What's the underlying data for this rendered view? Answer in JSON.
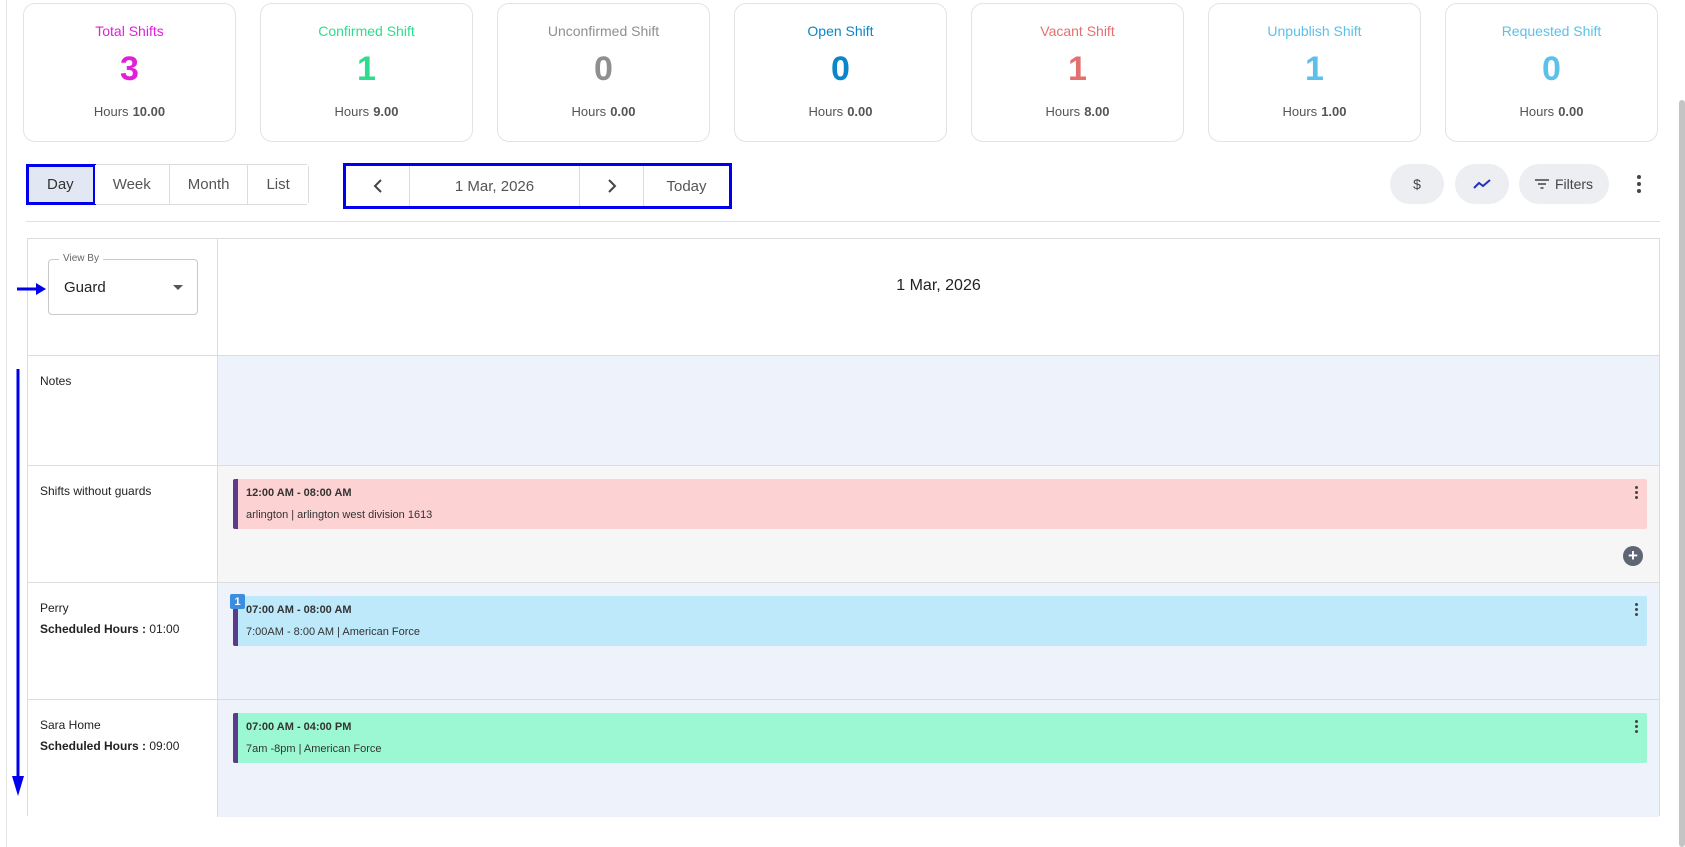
{
  "summary_cards": [
    {
      "title": "Total Shifts",
      "value": "3",
      "hours_label": "Hours",
      "hours": "10.00",
      "color": "#e020d8"
    },
    {
      "title": "Confirmed Shift",
      "value": "1",
      "hours_label": "Hours",
      "hours": "9.00",
      "color": "#2edc8e"
    },
    {
      "title": "Unconfirmed Shift",
      "value": "0",
      "hours_label": "Hours",
      "hours": "0.00",
      "color": "#8f8f8f"
    },
    {
      "title": "Open Shift",
      "value": "0",
      "hours_label": "Hours",
      "hours": "0.00",
      "color": "#0a86c9"
    },
    {
      "title": "Vacant Shift",
      "value": "1",
      "hours_label": "Hours",
      "hours": "8.00",
      "color": "#e46f6f"
    },
    {
      "title": "Unpublish Shift",
      "value": "1",
      "hours_label": "Hours",
      "hours": "1.00",
      "color": "#5bc1ea"
    },
    {
      "title": "Requested Shift",
      "value": "0",
      "hours_label": "Hours",
      "hours": "0.00",
      "color": "#5bc1ea"
    }
  ],
  "view_tabs": {
    "day": "Day",
    "week": "Week",
    "month": "Month",
    "list": "List",
    "active": "Day"
  },
  "date_nav": {
    "prev_icon": "chevron-left-icon",
    "date": "1 Mar, 2026",
    "next_icon": "chevron-right-icon",
    "today": "Today"
  },
  "toolbar": {
    "dollar": "$",
    "filters": "Filters"
  },
  "grid": {
    "view_by_label": "View By",
    "view_by_value": "Guard",
    "header_date": "1 Mar, 2026",
    "notes_label": "Notes",
    "unassigned_label": "Shifts without guards",
    "unassigned_shift": {
      "time": "12:00 AM - 08:00 AM",
      "desc": "arlington | arlington west division 1613"
    },
    "guards": [
      {
        "name": "Perry",
        "hours_label": "Scheduled Hours :",
        "hours": "01:00",
        "badge": "1",
        "shift_time": "07:00 AM - 08:00 AM",
        "shift_desc": "7:00AM - 8:00 AM | American Force"
      },
      {
        "name": "Sara Home",
        "hours_label": "Scheduled Hours :",
        "hours": "09:00",
        "shift_time": "07:00 AM - 04:00 PM",
        "shift_desc": "7am -8pm | American Force"
      }
    ]
  },
  "colors": {
    "highlight": "#0000ee",
    "active_tab_bg": "#e2e8f3"
  }
}
